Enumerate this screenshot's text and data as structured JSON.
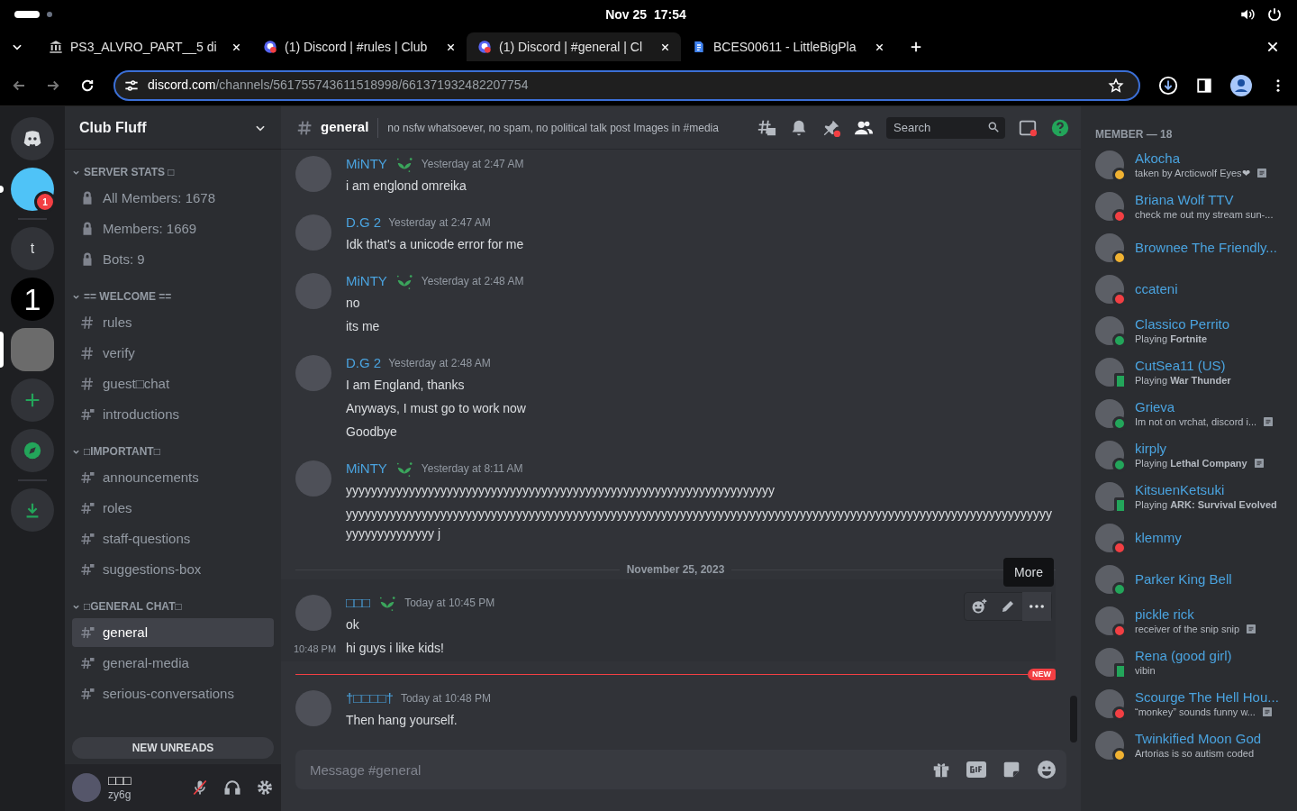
{
  "system_bar": {
    "date": "Nov 25",
    "time": "17:54"
  },
  "browser": {
    "tabs": [
      {
        "title": "PS3_ALVRO_PART__5 di",
        "kind": "archive",
        "selected": false
      },
      {
        "title": "(1) Discord | #rules | Club",
        "kind": "discord",
        "selected": false
      },
      {
        "title": "(1) Discord | #general | Cl",
        "kind": "discord",
        "selected": true
      },
      {
        "title": "BCES00611 - LittleBigPla",
        "kind": "doc",
        "selected": false
      }
    ],
    "url": {
      "domain": "discord.com",
      "path": "/channels/561755743611518998/661371932482207754"
    }
  },
  "servers": [
    {
      "kind": "home",
      "selected": false
    },
    {
      "kind": "avatar",
      "color": "#4fc3f7",
      "badge": "1",
      "selected": false,
      "unread": true
    },
    {
      "kind": "letter",
      "label": "t",
      "selected": false
    },
    {
      "kind": "letter-black",
      "label": "1",
      "selected": false
    },
    {
      "kind": "avatar",
      "color": "#6b6b6b",
      "selected": true
    },
    {
      "kind": "add",
      "selected": false
    },
    {
      "kind": "explore",
      "selected": false
    },
    {
      "kind": "download",
      "selected": false
    }
  ],
  "server_name": "Club Fluff",
  "categories": [
    {
      "name": "SERVER STATS □",
      "expanded": true,
      "channels": [
        {
          "name": "All Members: 1678",
          "kind": "stat",
          "selected": false
        },
        {
          "name": "Members: 1669",
          "kind": "stat",
          "selected": false
        },
        {
          "name": "Bots: 9",
          "kind": "stat",
          "selected": false
        }
      ]
    },
    {
      "name": "== WELCOME ==",
      "expanded": true,
      "channels": [
        {
          "name": "rules",
          "kind": "text",
          "selected": false
        },
        {
          "name": "verify",
          "kind": "text",
          "selected": false
        },
        {
          "name": "guest□chat",
          "kind": "text",
          "selected": false
        },
        {
          "name": "introductions",
          "kind": "private",
          "selected": false
        }
      ]
    },
    {
      "name": "□IMPORTANT□",
      "expanded": true,
      "channels": [
        {
          "name": "announcements",
          "kind": "private",
          "selected": false
        },
        {
          "name": "roles",
          "kind": "private",
          "selected": false
        },
        {
          "name": "staff-questions",
          "kind": "private",
          "selected": false
        },
        {
          "name": "suggestions-box",
          "kind": "private",
          "selected": false
        }
      ]
    },
    {
      "name": "□GENERAL CHAT□",
      "expanded": true,
      "channels": [
        {
          "name": "general",
          "kind": "private",
          "selected": true
        },
        {
          "name": "general-media",
          "kind": "private",
          "selected": false
        },
        {
          "name": "serious-conversations",
          "kind": "private",
          "selected": false
        }
      ]
    }
  ],
  "new_unreads": "NEW UNREADS",
  "user": {
    "name": "□□□",
    "tag": "zy6g"
  },
  "header": {
    "channel": "general",
    "topic": "no nsfw whatsoever, no spam, no political talk post Images in #media",
    "search_placeholder": "Search"
  },
  "messages": [
    {
      "kind": "group",
      "author": "MiNTY",
      "badge": true,
      "time": "Yesterday at 2:47 AM",
      "lines": [
        "i am englond omreika"
      ]
    },
    {
      "kind": "group",
      "author": "D.G 2",
      "badge": false,
      "time": "Yesterday at 2:47 AM",
      "lines": [
        "Idk that's a unicode error for me"
      ]
    },
    {
      "kind": "group",
      "author": "MiNTY",
      "badge": true,
      "time": "Yesterday at 2:48 AM",
      "lines": [
        "no",
        "its me"
      ]
    },
    {
      "kind": "group",
      "author": "D.G 2",
      "badge": false,
      "time": "Yesterday at 2:48 AM",
      "lines": [
        "I am England, thanks",
        "Anyways, I must go to work now",
        "Goodbye"
      ]
    },
    {
      "kind": "group",
      "author": "MiNTY",
      "badge": true,
      "time": "Yesterday at 8:11 AM",
      "lines": [
        "yyyyyyyyyyyyyyyyyyyyyyyyyyyyyyyyyyyyyyyyyyyyyyyyyyyyyyyyyyyyyyyyyyyy",
        "yyyyyyyyyyyyyyyyyyyyyyyyyyyyyyyyyyyyyyyyyyyyyyyyyyyyyyyyyyyyyyyyyyyyyyyyyyyyyyyyyyyyyyyyyyyyyyyyyyyyyyyyyyyyyyyyyyyyyyyyyyyyyy j"
      ]
    },
    {
      "kind": "date",
      "label": "November 25, 2023"
    },
    {
      "kind": "group",
      "author": "□□□",
      "badge": true,
      "time": "Today at 10:45 PM",
      "lines": [
        "ok",
        "hi guys i like kids!"
      ],
      "hover_time": "10:48 PM",
      "tooltip": "More"
    },
    {
      "kind": "new",
      "label": "NEW"
    },
    {
      "kind": "group",
      "author": "†□□□□†",
      "badge": false,
      "time": "Today at 10:48 PM",
      "lines": [
        "Then hang yourself."
      ]
    }
  ],
  "composer": {
    "placeholder": "Message #general"
  },
  "members_heading": "MEMBER — 18",
  "members": [
    {
      "name": "Akocha",
      "activity": "taken by Arcticwolf Eyes❤",
      "kind": "idle",
      "note": true
    },
    {
      "name": "Briana Wolf TTV",
      "activity": "check me out my stream sun-...",
      "kind": "dnd",
      "note": false
    },
    {
      "name": "Brownee The Friendly...",
      "kind": "idle"
    },
    {
      "name": "ccateni",
      "kind": "dnd"
    },
    {
      "name": "Classico Perrito",
      "activity": "Playing **Fortnite**",
      "kind": "online",
      "note": false
    },
    {
      "name": "CutSea11 (US)",
      "activity": "Playing **War Thunder**",
      "kind": "mobile",
      "note": false
    },
    {
      "name": "Grieva",
      "activity": "Im not on vrchat, discord i...",
      "kind": "online",
      "note": true
    },
    {
      "name": "kirply",
      "activity": "Playing **Lethal Company**",
      "kind": "online",
      "note": true
    },
    {
      "name": "KitsuenKetsuki",
      "activity": "Playing **ARK: Survival Evolved**",
      "kind": "mobile",
      "note": false
    },
    {
      "name": "klemmy",
      "kind": "dnd"
    },
    {
      "name": "Parker King Bell",
      "kind": "online"
    },
    {
      "name": "pickle rick",
      "activity": "receiver of the snip snip",
      "kind": "dnd",
      "note": true
    },
    {
      "name": "Rena (good girl)",
      "activity": "vibin",
      "kind": "mobile",
      "note": false
    },
    {
      "name": "Scourge The Hell Hou...",
      "activity": "“monkey” sounds funny w...",
      "kind": "dnd",
      "note": true
    },
    {
      "name": "Twinkified Moon God",
      "activity": "Artorias is so autism coded",
      "kind": "idle",
      "note": false
    }
  ]
}
